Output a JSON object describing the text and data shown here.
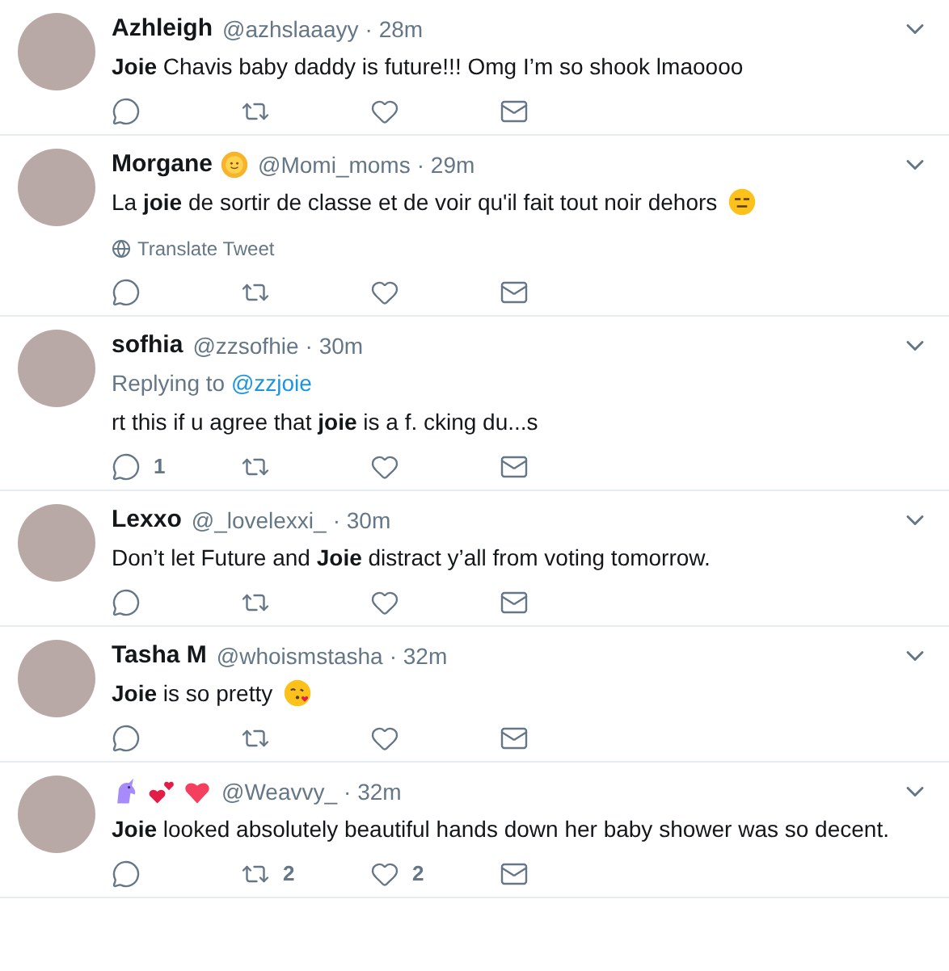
{
  "tweets": [
    {
      "name": "Azhleigh",
      "handle": "@azhslaaayy",
      "time": "· 28m",
      "text": "**Joie** Chavis baby daddy is future!!! Omg I’m so shook lmaoooo"
    },
    {
      "name": "Morgane",
      "name_emojis": [
        {
          "kind": "sun"
        }
      ],
      "handle": "@Momi_moms",
      "time": "· 29m",
      "text": "La **joie** de sortir de classe et de voir qu'il fait tout noir dehors",
      "text_emoji": {
        "kind": "expressionless"
      },
      "translate": "Translate Tweet"
    },
    {
      "name": "sofhia",
      "handle": "@zzsofhie",
      "time": "· 30m",
      "reply_prefix": "Replying to",
      "reply_to": "@zzjoie",
      "text": "rt this if u agree that **joie** is a f. cking du...s",
      "reply_count": "1"
    },
    {
      "name": "Lexxo",
      "handle": "@_lovelexxi_",
      "time": "· 30m",
      "text": "Don’t let Future and **Joie** distract y’all from voting tomorrow."
    },
    {
      "name": "Tasha M",
      "handle": "@whoismstasha",
      "time": "· 32m",
      "text": "**Joie** is so pretty",
      "text_emoji": {
        "kind": "kiss"
      }
    },
    {
      "name_emojis": [
        {
          "kind": "unicorn"
        },
        {
          "kind": "hearts"
        },
        {
          "kind": "heart"
        }
      ],
      "handle": "@Weavvy_",
      "time": "· 32m",
      "text": "**Joie** looked absolutely beautiful hands down her baby shower was so decent.",
      "retweet_count": "2",
      "like_count": "2"
    }
  ]
}
